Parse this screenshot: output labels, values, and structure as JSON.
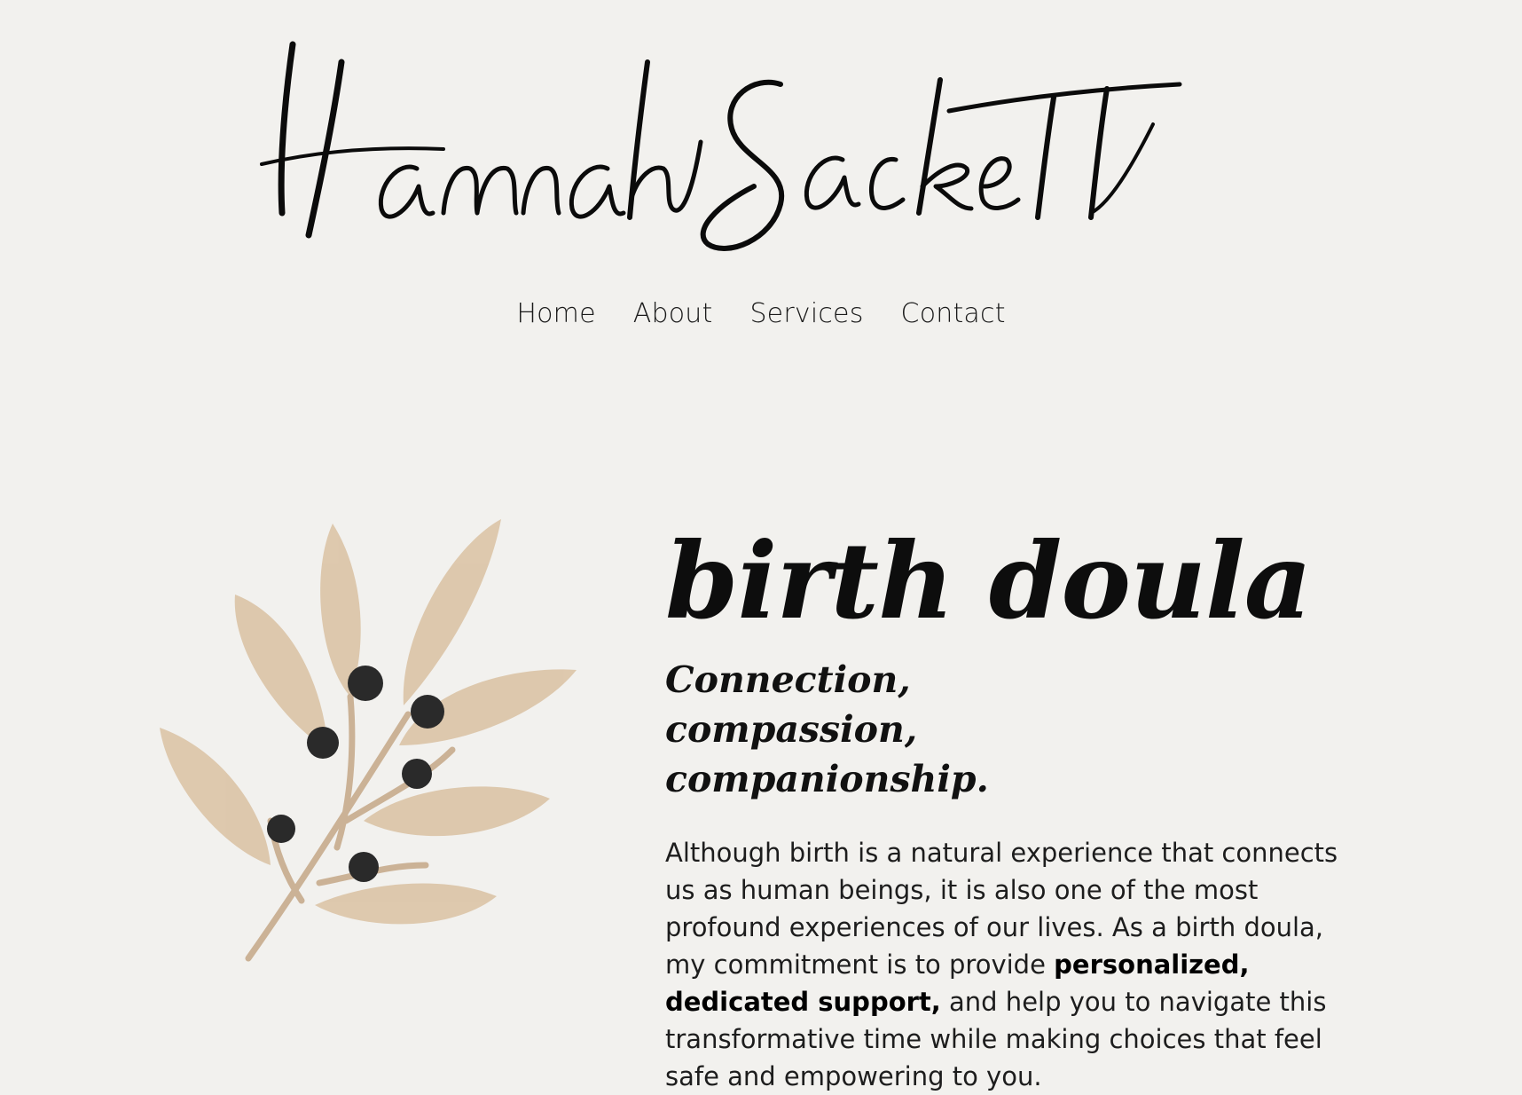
{
  "header": {
    "logo_text": "Hannah Sackett"
  },
  "nav": {
    "items": [
      {
        "label": "Home"
      },
      {
        "label": "About"
      },
      {
        "label": "Services"
      },
      {
        "label": "Contact"
      }
    ]
  },
  "hero": {
    "title": "birth doula",
    "subtitle": "Connection, compassion, companionship.",
    "body_before": "Although birth is a natural experience that connects us as human beings, it is also one of the most profound experiences of our lives. As a birth doula, my commitment is to provide ",
    "body_bold": "personalized, dedicated support,",
    "body_after": " and help you to navigate this transformative time while making choices that feel safe and empowering to you."
  },
  "colors": {
    "background": "#f2f1ee",
    "leaf": "#dcc6aa",
    "berry": "#2a2a2a",
    "text": "#111111"
  },
  "icons": {
    "illustration": "olive-branch-icon"
  }
}
